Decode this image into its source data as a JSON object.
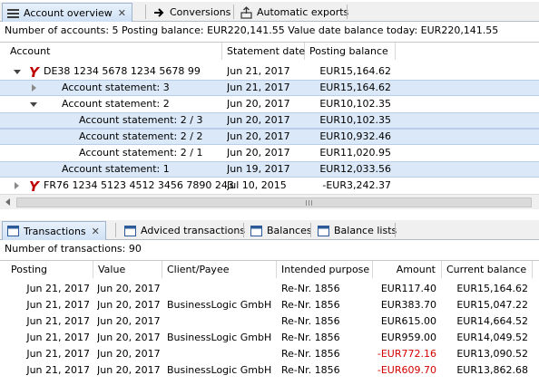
{
  "top_tabs": [
    {
      "label": "Account overview",
      "active": true
    },
    {
      "label": "Conversions",
      "active": false
    },
    {
      "label": "Automatic exports",
      "active": false
    }
  ],
  "accounts_summary": "Number of accounts: 5   Posting balance: EUR220,141.55   Value date balance today: EUR220,141.55",
  "accounts_columns": [
    "Account",
    "Statement date",
    "Posting balance"
  ],
  "accounts_rows": [
    {
      "name": "DE38 1234 5678 1234 5678 99",
      "date": "Jun 21, 2017",
      "balance": "EUR15,164.62"
    },
    {
      "name": "Account statement: 3",
      "date": "Jun 21, 2017",
      "balance": "EUR15,164.62"
    },
    {
      "name": "Account statement: 2",
      "date": "Jun 20, 2017",
      "balance": "EUR10,102.35"
    },
    {
      "name": "Account statement: 2 / 3",
      "date": "Jun 20, 2017",
      "balance": "EUR10,102.35"
    },
    {
      "name": "Account statement: 2 / 2",
      "date": "Jun 20, 2017",
      "balance": "EUR10,932.46"
    },
    {
      "name": "Account statement: 2 / 1",
      "date": "Jun 20, 2017",
      "balance": "EUR11,020.95"
    },
    {
      "name": "Account statement: 1",
      "date": "Jun 19, 2017",
      "balance": "EUR12,033.56"
    },
    {
      "name": "FR76 1234 5123 4512 3456 7890 243",
      "date": "Jul 10, 2015",
      "balance": "-EUR3,242.37"
    }
  ],
  "bottom_tabs": [
    {
      "label": "Transactions",
      "active": true
    },
    {
      "label": "Adviced transactions",
      "active": false
    },
    {
      "label": "Balances",
      "active": false
    },
    {
      "label": "Balance lists",
      "active": false
    }
  ],
  "transactions_summary": "Number of transactions: 90",
  "transactions_columns": [
    "Posting",
    "Value",
    "Client/Payee",
    "Intended purpose",
    "Amount",
    "Current balance"
  ],
  "transactions_rows": [
    {
      "posting": "Jun 21, 2017",
      "value": "Jun 20, 2017",
      "payee": "",
      "purpose": "Re-Nr. 1856",
      "amount": "EUR117.40",
      "balance": "EUR15,164.62"
    },
    {
      "posting": "Jun 21, 2017",
      "value": "Jun 20, 2017",
      "payee": "BusinessLogic GmbH",
      "purpose": "Re-Nr. 1856",
      "amount": "EUR383.70",
      "balance": "EUR15,047.22"
    },
    {
      "posting": "Jun 21, 2017",
      "value": "Jun 20, 2017",
      "payee": "",
      "purpose": "Re-Nr. 1856",
      "amount": "EUR615.00",
      "balance": "EUR14,664.52"
    },
    {
      "posting": "Jun 21, 2017",
      "value": "Jun 20, 2017",
      "payee": "BusinessLogic GmbH",
      "purpose": "Re-Nr. 1856",
      "amount": "EUR959.00",
      "balance": "EUR14,049.52"
    },
    {
      "posting": "Jun 21, 2017",
      "value": "Jun 20, 2017",
      "payee": "",
      "purpose": "Re-Nr. 1856",
      "amount": "-EUR772.16",
      "balance": "EUR13,090.52"
    },
    {
      "posting": "Jun 21, 2017",
      "value": "Jun 20, 2017",
      "payee": "BusinessLogic GmbH",
      "purpose": "Re-Nr. 1856",
      "amount": "-EUR609.70",
      "balance": "EUR13,862.68"
    }
  ],
  "colors": {
    "negative_amount": "#d40000",
    "selection": "#dbe8f8",
    "account_icon": "#c00000"
  }
}
